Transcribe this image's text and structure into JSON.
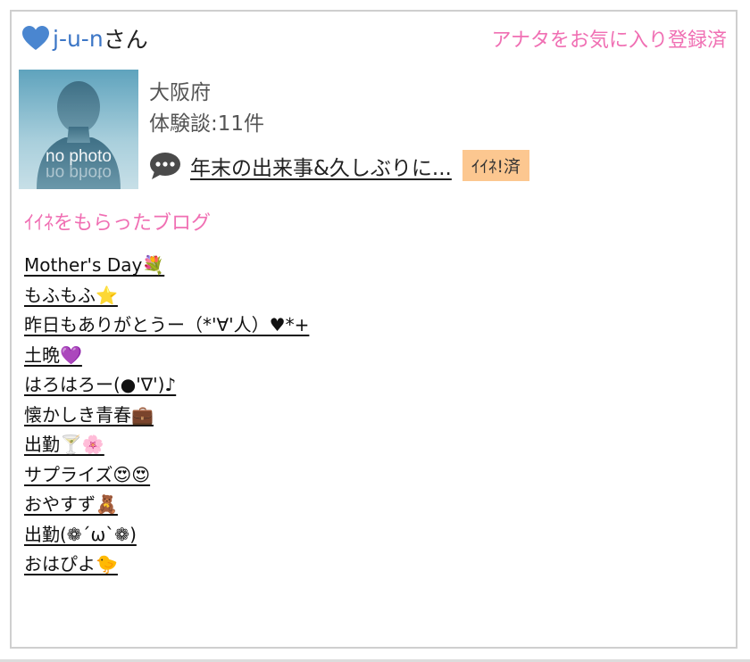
{
  "header": {
    "username": "j-u-n",
    "honorific": "さん",
    "favorite_status": "アナタをお気に入り登録済"
  },
  "profile": {
    "avatar_label": "no photo",
    "prefecture": "大阪府",
    "review_count_label": "体験談:11件",
    "latest_post_title": "年末の出来事&久しぶりに...",
    "liked_badge": "ｲｲﾈ!済"
  },
  "blogs": {
    "section_title": "ｲｲﾈをもらったブログ",
    "items": [
      "Mother's Day💐",
      "もふもふ⭐",
      "昨日もありがとうー（*'∀'人）♥*+",
      "土晩💜",
      "はろはろー(●'∇')♪",
      "懐かしき青春💼",
      "出勤🍸🌸",
      "サプライズ😍😍",
      "おやすず🧸",
      "出勤(❁´ω`❁)",
      "おはぴよ🐤"
    ]
  },
  "colors": {
    "accent_pink": "#f06fb3",
    "username_blue": "#3c76c6",
    "badge_orange": "#fcc790",
    "border_gray": "#cfcfcf"
  },
  "icons": {
    "heart": "blue-heart-icon",
    "speech": "speech-bubble-icon",
    "avatar": "silhouette-placeholder"
  }
}
